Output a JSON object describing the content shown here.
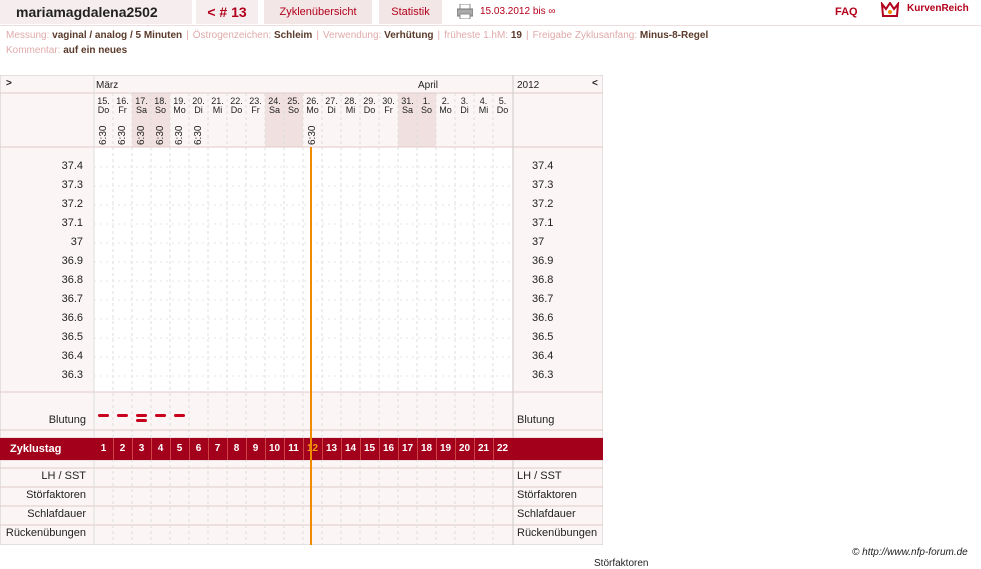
{
  "header": {
    "username": "mariamagdalena2502",
    "cycle": "< # 13",
    "tab_overview": "Zyklenübersicht",
    "tab_stats": "Statistik",
    "date_range": "15.03.2012 bis ∞",
    "faq": "FAQ",
    "logo_text": "KurvenReich"
  },
  "info": {
    "line1": [
      {
        "label": "Messung:",
        "value": "vaginal / analog / 5 Minuten"
      },
      {
        "label": "Östrogenzeichen:",
        "value": "Schleim"
      },
      {
        "label": "Verwendung:",
        "value": "Verhütung"
      },
      {
        "label": "früheste 1.hM:",
        "value": "19"
      },
      {
        "label": "Freigabe Zyklusanfang:",
        "value": "Minus-8-Regel"
      }
    ],
    "line2": [
      {
        "label": "Kommentar:",
        "value": "auf ein neues"
      }
    ]
  },
  "chart": {
    "nav_left": ">",
    "nav_right": "<",
    "year": "2012",
    "month1": "März",
    "month2": "April",
    "days": [
      {
        "d": "15.",
        "w": "Do",
        "t": "6:30"
      },
      {
        "d": "16.",
        "w": "Fr",
        "t": "6:30"
      },
      {
        "d": "17.",
        "w": "Sa",
        "t": "6:30"
      },
      {
        "d": "18.",
        "w": "So",
        "t": "6:30"
      },
      {
        "d": "19.",
        "w": "Mo",
        "t": "6:30"
      },
      {
        "d": "20.",
        "w": "Di",
        "t": "6:30"
      },
      {
        "d": "21.",
        "w": "Mi",
        "t": ""
      },
      {
        "d": "22.",
        "w": "Do",
        "t": ""
      },
      {
        "d": "23.",
        "w": "Fr",
        "t": ""
      },
      {
        "d": "24.",
        "w": "Sa",
        "t": ""
      },
      {
        "d": "25.",
        "w": "So",
        "t": ""
      },
      {
        "d": "26.",
        "w": "Mo",
        "t": "6:30"
      },
      {
        "d": "27.",
        "w": "Di",
        "t": ""
      },
      {
        "d": "28.",
        "w": "Mi",
        "t": ""
      },
      {
        "d": "29.",
        "w": "Do",
        "t": ""
      },
      {
        "d": "30.",
        "w": "Fr",
        "t": ""
      },
      {
        "d": "31.",
        "w": "Sa",
        "t": ""
      },
      {
        "d": "1.",
        "w": "So",
        "t": ""
      },
      {
        "d": "2.",
        "w": "Mo",
        "t": ""
      },
      {
        "d": "3.",
        "w": "Di",
        "t": ""
      },
      {
        "d": "4.",
        "w": "Mi",
        "t": ""
      },
      {
        "d": "5.",
        "w": "Do",
        "t": ""
      }
    ],
    "temps": [
      "37.4",
      "37.3",
      "37.2",
      "37.1",
      "37",
      "36.9",
      "36.8",
      "36.7",
      "36.6",
      "36.5",
      "36.4",
      "36.3"
    ],
    "bleeding_label": "Blutung",
    "bleeding": [
      1,
      1,
      2,
      1,
      1
    ],
    "cycle_label": "Zyklustag",
    "cycle_days": [
      "1",
      "2",
      "3",
      "4",
      "5",
      "6",
      "7",
      "8",
      "9",
      "10",
      "11",
      "12",
      "13",
      "14",
      "15",
      "16",
      "17",
      "18",
      "19",
      "20",
      "21",
      "22"
    ],
    "current_day": 12,
    "rows": [
      "LH / SST",
      "Störfaktoren",
      "Schlafdauer",
      "Rückenübungen"
    ],
    "colors": {
      "accent": "#b3001b",
      "band": "#a3001b",
      "today": "#f08a00"
    }
  },
  "footer": {
    "credit": "© http://www.nfp-forum.de",
    "cutoff": "Störfaktoren"
  }
}
